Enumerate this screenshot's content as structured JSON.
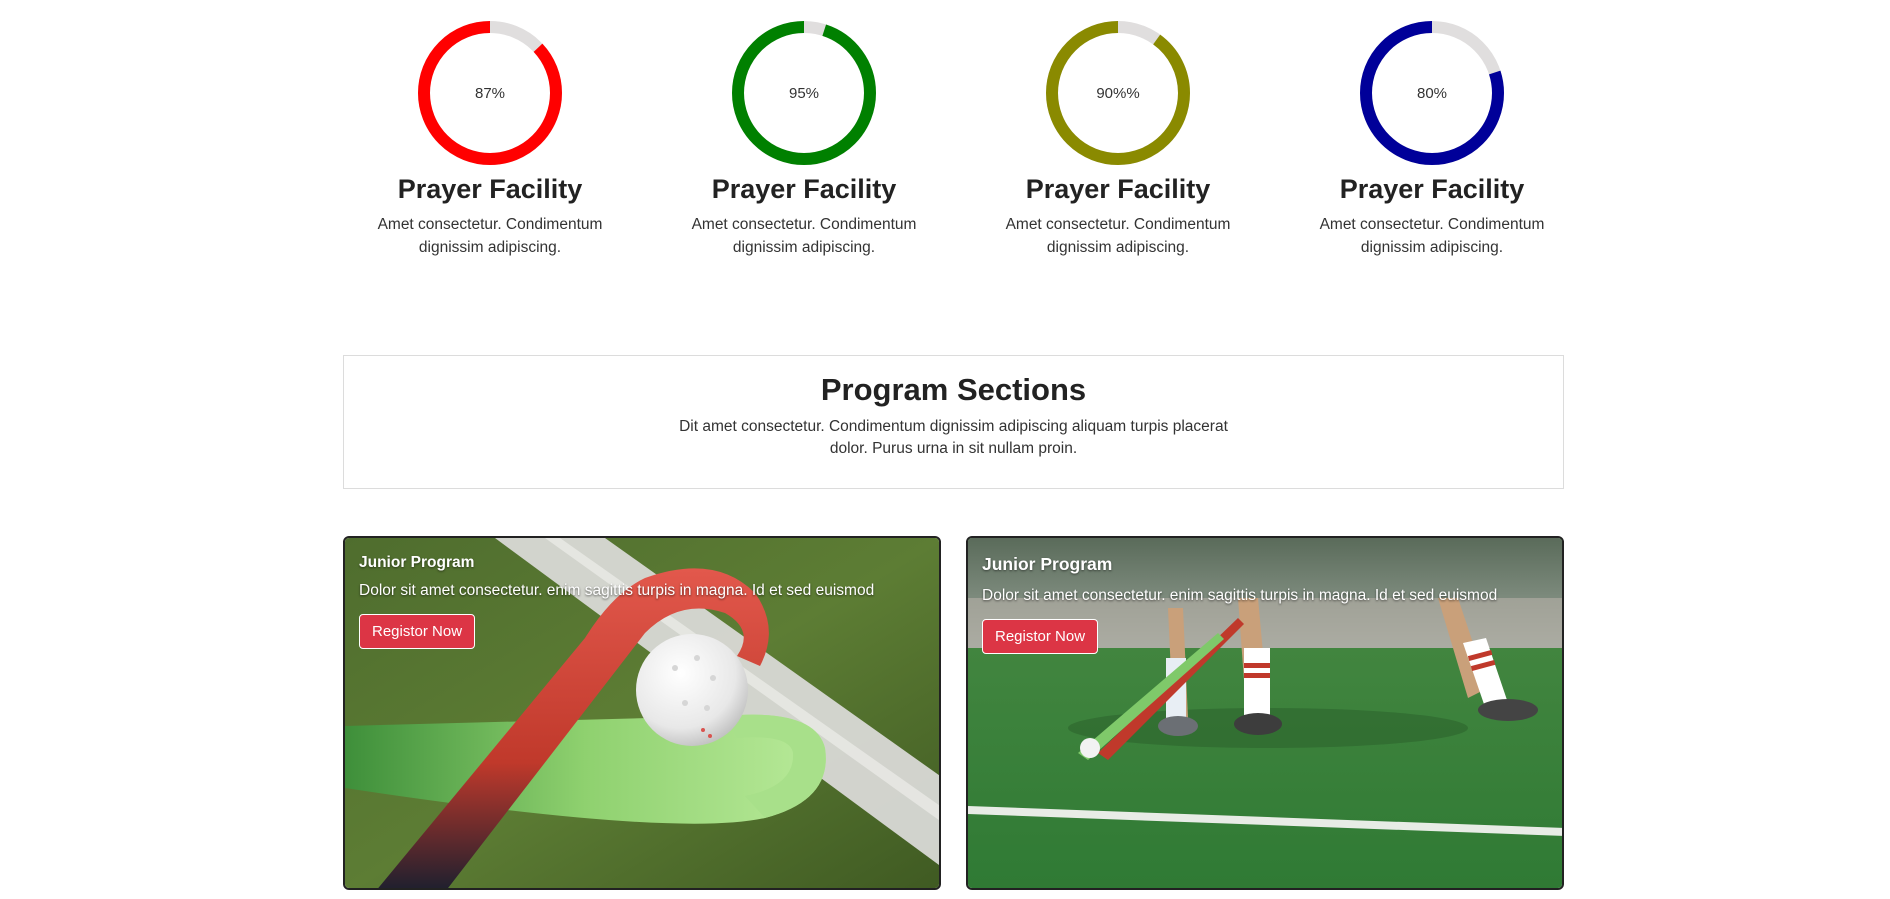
{
  "stats": [
    {
      "percent_label": "87%",
      "value": 0.87,
      "color": "#ff0000",
      "title": "Prayer Facility",
      "text": "Amet consectetur. Condimentum dignissim adipiscing."
    },
    {
      "percent_label": "95%",
      "value": 0.95,
      "color": "#008000",
      "title": "Prayer Facility",
      "text": "Amet consectetur. Condimentum dignissim adipiscing."
    },
    {
      "percent_label": "90%%",
      "value": 0.9,
      "color": "#8a8a00",
      "title": "Prayer Facility",
      "text": "Amet consectetur. Condimentum dignissim adipiscing."
    },
    {
      "percent_label": "80%",
      "value": 0.8,
      "color": "#000099",
      "title": "Prayer Facility",
      "text": "Amet consectetur. Condimentum dignissim adipiscing."
    }
  ],
  "program_section": {
    "title": "Program Sections",
    "description": "Dit amet consectetur. Condimentum dignissim adipiscing aliquam turpis placerat dolor. Purus urna in sit nullam proin."
  },
  "cards": [
    {
      "title": "Junior Program",
      "text": "Dolor sit amet consectetur. enim sagittis turpis in magna. Id et sed euismod",
      "button": "Registor Now"
    },
    {
      "title": "Junior Program",
      "text": "Dolor sit amet consectetur. enim sagittis turpis in magna. Id et sed euismod",
      "button": "Registor Now"
    }
  ],
  "colors": {
    "track": "#e0dede",
    "button": "#dc3545"
  }
}
